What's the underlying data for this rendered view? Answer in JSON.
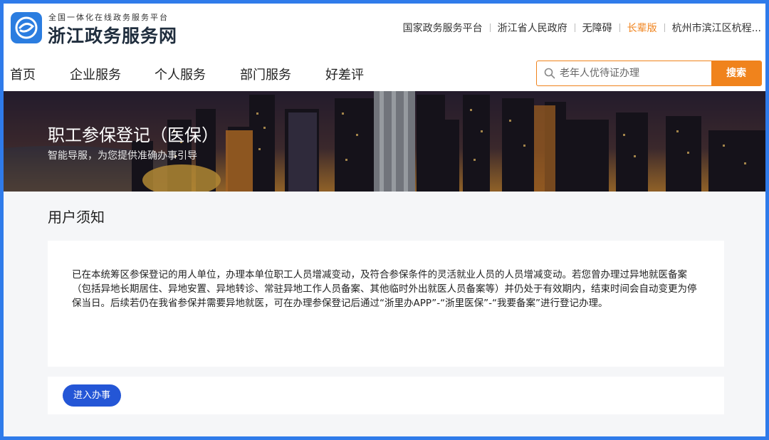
{
  "site": {
    "subtitle": "全国一体化在线政务服务平台",
    "name": "浙江政务服务网"
  },
  "toplinks": [
    {
      "label": "国家政务服务平台"
    },
    {
      "label": "浙江省人民政府"
    },
    {
      "label": "无障碍"
    },
    {
      "label": "长辈版"
    },
    {
      "label": "杭州市滨江区杭程..."
    }
  ],
  "nav": [
    {
      "label": "首页"
    },
    {
      "label": "企业服务"
    },
    {
      "label": "个人服务"
    },
    {
      "label": "部门服务"
    },
    {
      "label": "好差评"
    }
  ],
  "search": {
    "placeholder": "老年人优待证办理",
    "button_label": "搜索"
  },
  "banner": {
    "title": "职工参保登记（医保）",
    "subtitle": "智能导服，为您提供准确办事引导"
  },
  "notice": {
    "title": "用户须知",
    "text": "已在本统筹区参保登记的用人单位，办理本单位职工人员增减变动，及符合参保条件的灵活就业人员的人员增减变动。若您曾办理过异地就医备案（包括异地长期居住、异地安置、异地转诊、常驻异地工作人员备案、其他临时外出就医人员备案等）并仍处于有效期内，结束时间会自动变更为停保当日。后续若仍在我省参保并需要异地就医，可在办理参保登记后通过“浙里办APP”-“浙里医保”-“我要备案”进行登记办理。"
  },
  "action": {
    "enter_label": "进入办事"
  },
  "colors": {
    "accent_orange": "#f0831c",
    "primary_blue": "#2456d6",
    "frame_blue": "#2f7bea"
  }
}
